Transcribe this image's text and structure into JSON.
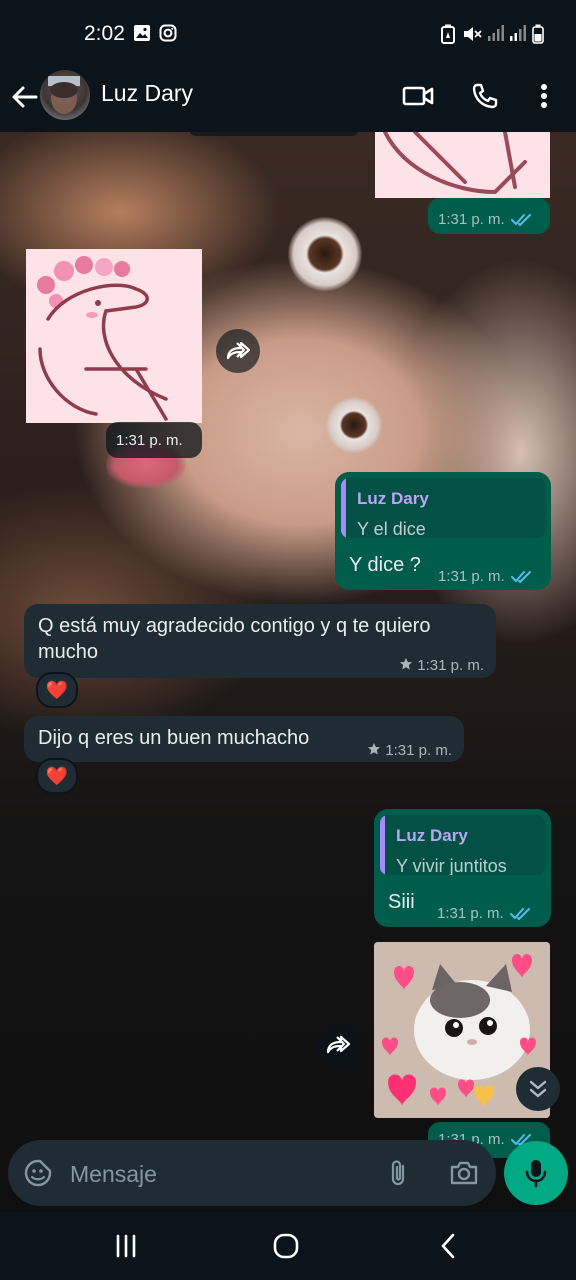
{
  "status_bar": {
    "time": "2:02"
  },
  "header": {
    "contact_name": "Luz Dary"
  },
  "messages": {
    "m1": {
      "time": "1:31 p. m."
    },
    "m2": {
      "time": "1:31 p. m."
    },
    "m3": {
      "quote_author": "Luz Dary",
      "quote_text": "Y el dice",
      "text": "Y dice ?",
      "time": "1:31 p. m."
    },
    "m4": {
      "text": "Q está muy agradecido contigo y q te quiero mucho",
      "time": "1:31 p. m.",
      "reaction": "❤️",
      "starred": true
    },
    "m5": {
      "text": "Dijo q eres un buen muchacho",
      "time": "1:31 p. m.",
      "reaction": "❤️",
      "starred": true
    },
    "m6": {
      "quote_author": "Luz Dary",
      "quote_text": "Y vivir juntitos",
      "text": "Siii",
      "time": "1:31 p. m."
    },
    "m7": {
      "time": "1:31 p. m."
    }
  },
  "composer": {
    "placeholder": "Mensaje"
  },
  "colors": {
    "incoming": "#1f2c34",
    "outgoing": "#005c4b",
    "accent": "#00a884",
    "read_ticks": "#53bdeb"
  },
  "icons": [
    "back-arrow",
    "video-call",
    "phone",
    "more-vert",
    "forward",
    "double-check",
    "star",
    "chevron-double-down",
    "sticker",
    "attach",
    "camera",
    "mic",
    "recents",
    "home",
    "back"
  ]
}
